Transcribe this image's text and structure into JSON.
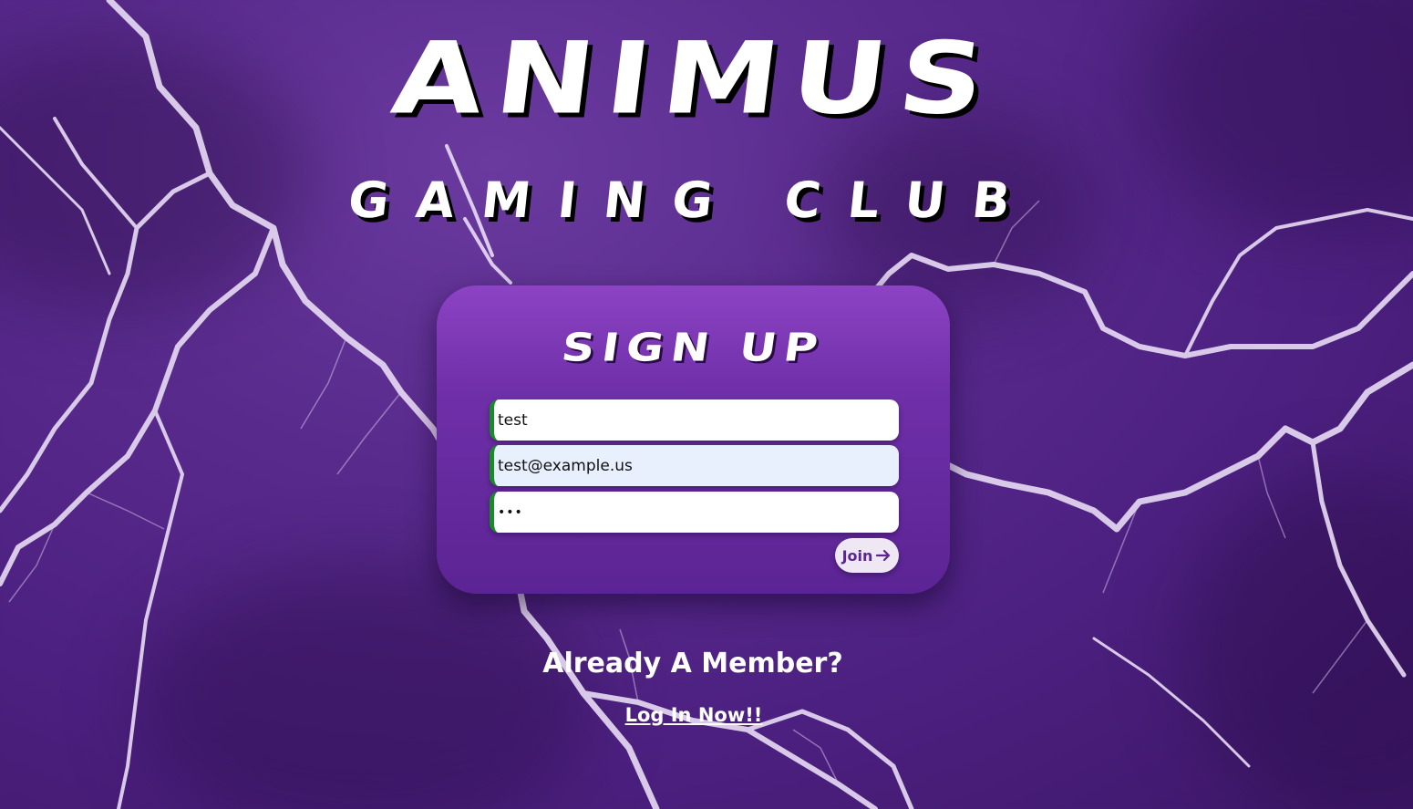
{
  "background": {
    "base_color": "#582a8c",
    "lightning_color": "#e9dcf5",
    "description_icon": "lightning-background"
  },
  "logo": {
    "title": "ANIMUS",
    "subtitle": "GAMING CLUB"
  },
  "signup_card": {
    "heading": "SIGN UP",
    "fields": {
      "name_value": "test",
      "email_value": "test@example.us",
      "password_value": "•••"
    },
    "join_label": "Join",
    "join_icon": "arrow-right-icon",
    "accent_color": "#1a8a2a"
  },
  "footer": {
    "member_prompt": "Already A Member?",
    "login_link": "Log In Now!!"
  }
}
